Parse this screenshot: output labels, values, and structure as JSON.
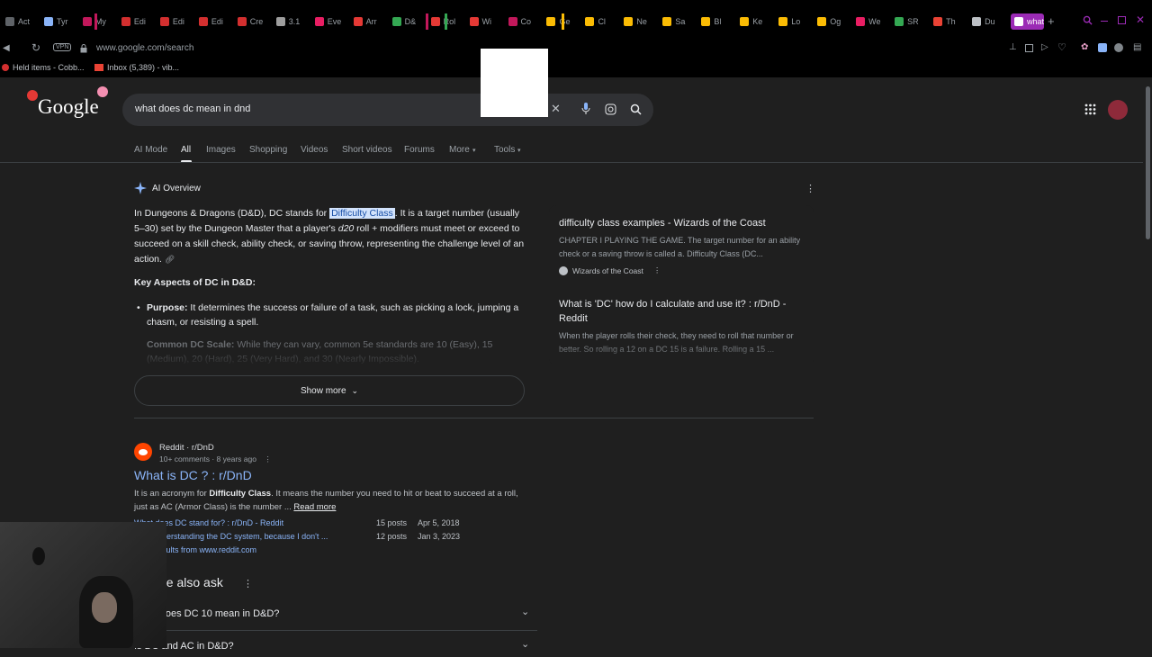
{
  "tabs": [
    {
      "label": "Act",
      "color": "#5f6368"
    },
    {
      "label": "Tyr",
      "color": "#8ab4f8"
    },
    {
      "label": "My",
      "color": "#c2185b"
    },
    {
      "label": "Edi",
      "color": "#d32f2f"
    },
    {
      "label": "Edi",
      "color": "#d32f2f"
    },
    {
      "label": "Edi",
      "color": "#d32f2f"
    },
    {
      "label": "Cre",
      "color": "#d32f2f"
    },
    {
      "label": "3.1",
      "color": "#9e9e9e"
    },
    {
      "label": "Eve",
      "color": "#e91e63"
    },
    {
      "label": "Arr",
      "color": "#e53935"
    },
    {
      "label": "D&",
      "color": "#34a853"
    },
    {
      "label": "Rol",
      "color": "#e53935"
    },
    {
      "label": "Wi",
      "color": "#e53935"
    },
    {
      "label": "Co",
      "color": "#c2185b"
    },
    {
      "label": "Ge",
      "color": "#fbbc04"
    },
    {
      "label": "Cl",
      "color": "#fbbc04"
    },
    {
      "label": "Ne",
      "color": "#fbbc04"
    },
    {
      "label": "Sa",
      "color": "#fbbc04"
    },
    {
      "label": "Bl",
      "color": "#fbbc04"
    },
    {
      "label": "Ke",
      "color": "#fbbc04"
    },
    {
      "label": "Lo",
      "color": "#fbbc04"
    },
    {
      "label": "Og",
      "color": "#fbbc04"
    },
    {
      "label": "We",
      "color": "#e91e63"
    },
    {
      "label": "SR",
      "color": "#34a853"
    },
    {
      "label": "Th",
      "color": "#ea4335"
    },
    {
      "label": "Du",
      "color": "#bdc1c6"
    },
    {
      "label": "what do",
      "color": "#ffffff"
    }
  ],
  "toolbar": {
    "vpn_label": "VPN",
    "url": "www.google.com/search"
  },
  "bookmarks": [
    {
      "label": "Held items - Cobb..."
    },
    {
      "label": "Inbox (5,389) - vib..."
    }
  ],
  "search": {
    "logo": "Google",
    "query": "what does dc mean in dnd"
  },
  "nav": {
    "items": [
      "AI Mode",
      "All",
      "Images",
      "Shopping",
      "Videos",
      "Short videos",
      "Forums",
      "More",
      "Tools"
    ],
    "active": "All"
  },
  "ai_overview": {
    "title": "AI Overview",
    "intro_1": "In Dungeons & Dragons (D&D), DC stands for ",
    "highlight": "Difficulty Class",
    "intro_2": ". It is a target number (usually 5–30) set by the Dungeon Master that a player's ",
    "d20": "d20",
    "intro_3": " roll + modifiers must meet or exceed to succeed on a skill check, ability check, or saving throw, representing the challenge level of an action.",
    "key_heading": "Key Aspects of DC in D&D:",
    "purpose_label": "Purpose:",
    "purpose_text": " It determines the success or failure of a task, such as picking a lock, jumping a chasm, or resisting a spell.",
    "scale_label": "Common DC Scale:",
    "scale_text": " While they can vary, common 5e standards are 10 (Easy), 15 (Medium), 20 (Hard), 25 (Very Hard), and 30 (Nearly Impossible).",
    "show_more": "Show more"
  },
  "side_sources": [
    {
      "title": "difficulty class examples - Wizards of the Coast",
      "snippet": "CHAPTER I PLAYING THE GAME. The target number for an ability check or a saving throw is called a. Difficulty Class (DC...",
      "source": "Wizards of the Coast"
    },
    {
      "title": "What is 'DC' how do I calculate and use it? : r/DnD - Reddit",
      "snippet": "When the player rolls their check, they need to roll that number or better. So rolling a 12 on a DC 15 is a failure. Rolling a 15 ..."
    }
  ],
  "result": {
    "site": "Reddit · r/DnD",
    "meta": "10+ comments · 8 years ago",
    "title": "What is DC ? : r/DnD",
    "snippet_1": "It is an acronym for ",
    "snippet_bold": "Difficulty Class",
    "snippet_2": ". It means the number you need to hit or beat to succeed at a roll, just as AC (Armor Class) is the number ... ",
    "read_more": "Read more",
    "sublinks": [
      {
        "title": "What does DC stand for? : r/DnD - Reddit",
        "posts": "15 posts",
        "date": "Apr 5, 2018"
      },
      {
        "title": "Help understanding the DC system, because I don't ...",
        "posts": "12 posts",
        "date": "Jan 3, 2023"
      }
    ],
    "more_results": "More results from www.reddit.com"
  },
  "people_also_ask": {
    "title": "People also ask",
    "items": [
      "What does DC 10 mean in D&D?",
      "Is DC and AC in D&D?"
    ]
  },
  "colors": {
    "accent_link": "#8ab4f8",
    "highlight_bg": "#d2e3fc",
    "active_tab": "#9b2bb5",
    "background": "#1f1f1f"
  }
}
